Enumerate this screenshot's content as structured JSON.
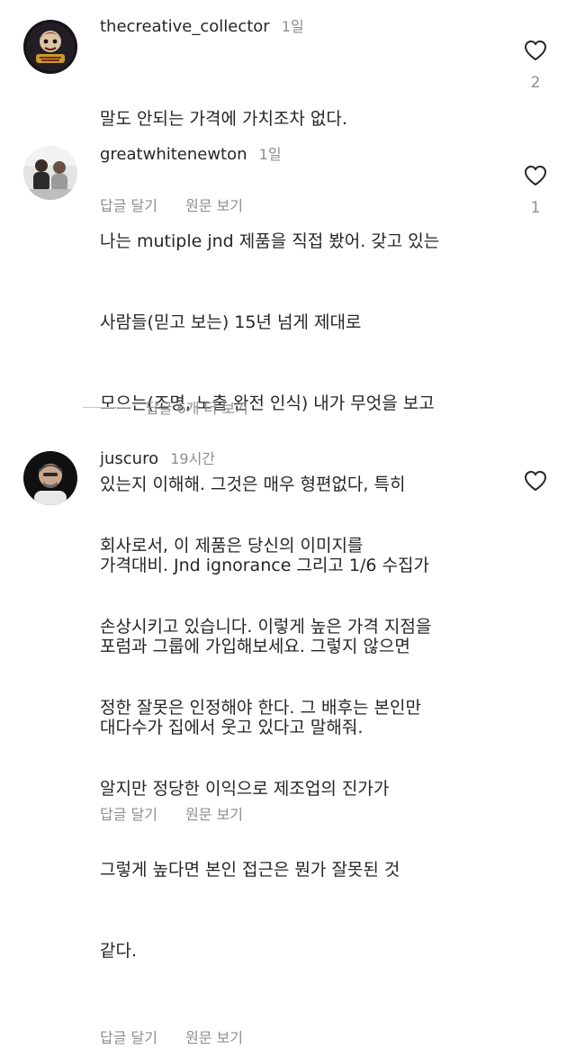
{
  "colors": {
    "text": "#262626",
    "secondary": "#8e8e8e",
    "background": "#ffffff"
  },
  "comments": [
    {
      "username": "thecreative_collector",
      "time": "1일",
      "lines": [
        "말도 안되는 가격에 가치조차 없다."
      ],
      "reply_label": "답글 달기",
      "original_label": "원문 보기",
      "like_count": "2",
      "like_icon": "heart-outline-icon"
    },
    {
      "username": "greatwhitenewton",
      "time": "1일",
      "lines": [
        "나는 mutiple jnd 제품을 직접 봤어. 갖고 있는",
        "사람들(믿고 보는) 15년 넘게 제대로",
        "모으는(조명, 노출 완전 인식) 내가 무엇을 보고",
        "있는지 이해해. 그것은 매우 형편없다, 특히",
        "가격대비. Jnd ignorance 그리고 1/6 수집가",
        "포럼과 그룹에 가입해보세요. 그렇지 않으면",
        "대다수가 집에서 웃고 있다고 말해줘."
      ],
      "reply_label": "답글 달기",
      "original_label": "원문 보기",
      "like_count": "1",
      "like_icon": "heart-outline-icon"
    },
    {
      "username": "juscuro",
      "time": "19시간",
      "lines": [
        "회사로서, 이 제품은 당신의 이미지를",
        "손상시키고 있습니다. 이렇게 높은 가격 지점을",
        "정한 잘못은 인정해야 한다. 그 배후는 본인만",
        "알지만 정당한 이익으로 제조업의 진가가",
        "그렇게 높다면 본인 접근은 뭔가 잘못된 것",
        "같다."
      ],
      "reply_label": "답글 달기",
      "original_label": "원문 보기",
      "like_count": "",
      "like_icon": "heart-outline-icon"
    }
  ],
  "more_replies_label": "답글 6개 더 보기"
}
